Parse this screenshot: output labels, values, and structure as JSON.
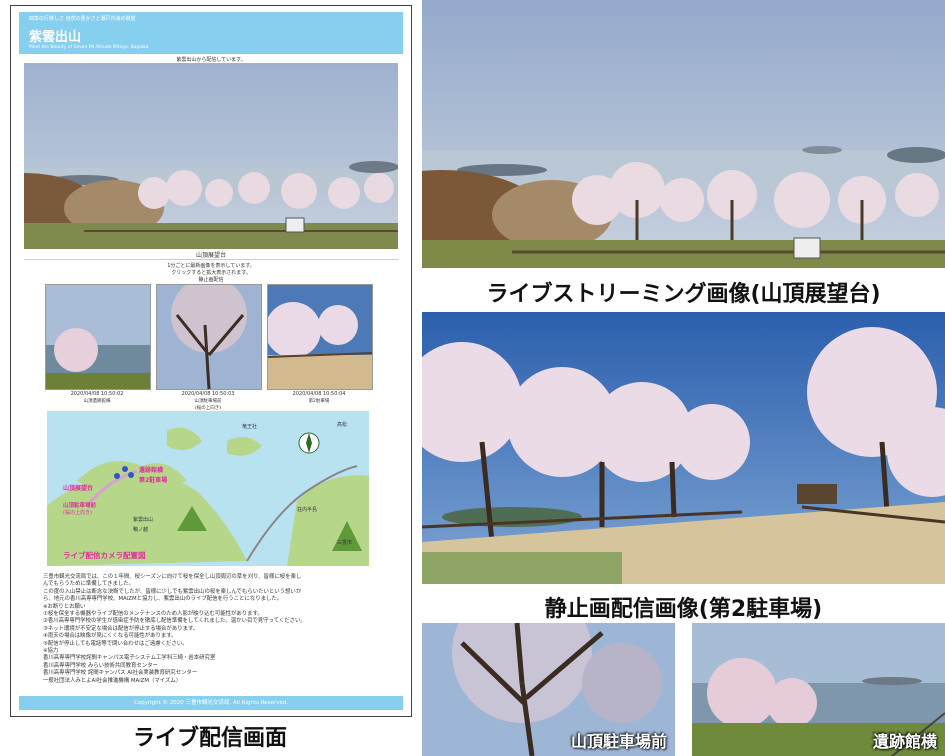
{
  "site": {
    "tagline": "四季の行楽しさ 自然の豊かさと瀬戸内海の眺望",
    "title": "紫雲出山",
    "subtitle": "Meet the Beauty of Seven Mt.Shiude Mitoyo, Kagawa",
    "live_notice": "紫雲出山から配信しています。",
    "live_caption": "山頂展望台",
    "still_notice_1": "1分ごとに最新画像を表示しています。",
    "still_notice_2": "クリックすると拡大表示されます。",
    "still_heading": "静止画配信",
    "thumbs": [
      {
        "time": "2020/04/08 10:50:02",
        "name": "山頂遺跡館横"
      },
      {
        "time": "2020/04/08 10:50:03",
        "name": "山頂駐車場前",
        "note": "(桜の上向き)"
      },
      {
        "time": "2020/04/08 10:50:04",
        "name": "第2駐車場"
      }
    ],
    "map": {
      "title": "ライブ配信カメラ配置図",
      "labels": [
        "山頂展望台",
        "遺跡館横",
        "第2駐車場",
        "山頂駐車場前",
        "(桜の上向き)",
        "紫雲出山",
        "竜王社",
        "鴨ノ越",
        "三豊市",
        "高松",
        "荘内半島"
      ]
    },
    "notice_lines": [
      "三豊市観光交流局では、この１年間、桜シーズンに向けて桜を保全し山頂周辺の草を刈り、皆様に桜を楽し",
      "んでもらうために準備してきました。",
      "この度の入山禁止は断念な決断でしたが、皆様に少しでも紫雲出山の桜を楽しんでもらいたいという想いか",
      "ら、地元の香川高専専門学校、MAiZMと協力し、紫雲出山のライブ配信を行うことになりました。",
      "※お断りとお願い",
      "①桜を保全する機器やライブ配信のメンテナンスのため人影が映り込む可能性があります。",
      "②香川高専専門学校の学生が感染症予防を徹底し配信準備をしてくれました。温かい目で見守ってください。",
      "③ネット環境が不安定な場合は配信が停止する場合があります。",
      "④雨天の場合は映像が見にくくなる可能性があります。",
      "⑤配信が停止しても電話等で問い合わせはご遠慮ください。",
      "※協力",
      "香川高専専門学校詫間キャンパス電子システム工学科三崎・岩本研究室",
      "香川高専専門学校 みらい技術共同教育センター",
      "香川高専専門学校 詫間キャンパス AI社会実装教育研究センター",
      "一般社団法人みとよAI社会推進機構 MAiZM（マイズム）"
    ],
    "copyright": "Copyright © 2020 三豊市観光交流局. All Rights Reserved."
  },
  "captions": {
    "left": "ライブ配信画面",
    "top_right": "ライブストリーミング画像(山頂展望台)",
    "mid_right": "静止画配信画像(第2駐車場)",
    "photo_bl": "山頂駐車場前",
    "photo_br": "遺跡館横"
  },
  "colors": {
    "header": "#87cfee",
    "map_title": "#e0309a",
    "map_label": "#e0309a"
  }
}
